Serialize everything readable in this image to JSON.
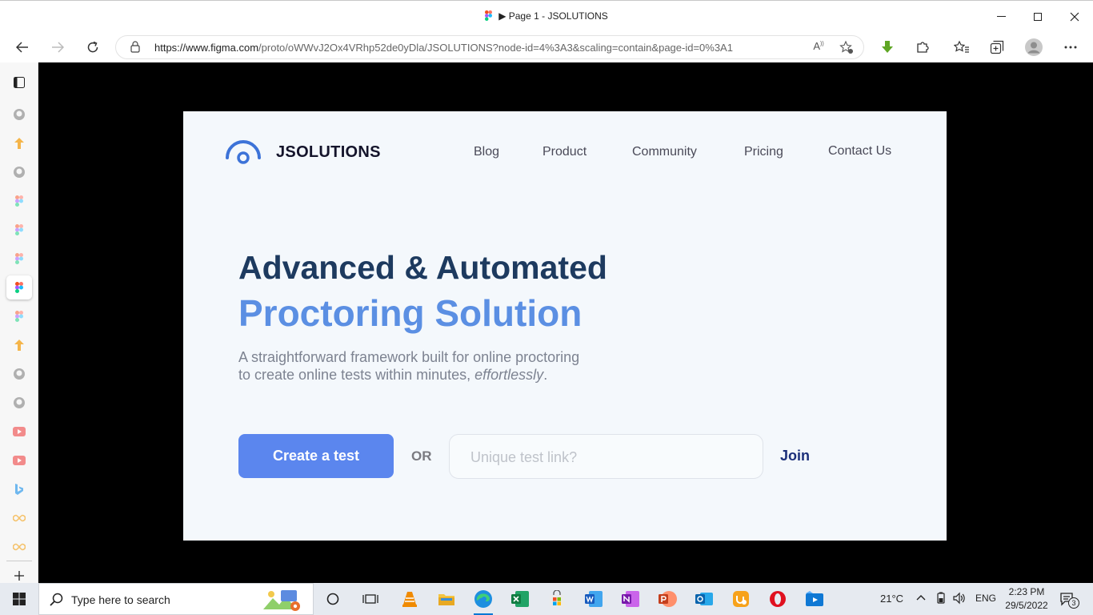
{
  "browser": {
    "window_title": "▶ Page 1 - JSOLUTIONS",
    "url": "https://www.figma.com/proto/oWWvJ2Ox4VRhp52de0yDla/JSOLUTIONS?node-id=4%3A3&scaling=contain&page-id=0%3A1",
    "url_host": "https://www.figma.com",
    "url_path": "/proto/oWWvJ2Ox4VRhp52de0yDla/JSOLUTIONS?node-id=4%3A3&scaling=contain&page-id=0%3A1"
  },
  "sidebar": {
    "items": [
      {
        "icon": "github-icon"
      },
      {
        "icon": "upload-arrow-icon"
      },
      {
        "icon": "github-icon"
      },
      {
        "icon": "figma-icon"
      },
      {
        "icon": "figma-icon"
      },
      {
        "icon": "figma-icon"
      },
      {
        "icon": "figma-icon",
        "active": true
      },
      {
        "icon": "figma-icon"
      },
      {
        "icon": "upload-arrow-icon"
      },
      {
        "icon": "github-icon"
      },
      {
        "icon": "github-icon"
      },
      {
        "icon": "youtube-icon"
      },
      {
        "icon": "youtube-icon"
      },
      {
        "icon": "bing-icon"
      },
      {
        "icon": "infinity-icon"
      },
      {
        "icon": "infinity-icon"
      }
    ]
  },
  "site": {
    "brand": "JSOLUTIONS",
    "nav": [
      "Blog",
      "Product",
      "Community",
      "Pricing",
      "Contact Us"
    ],
    "hero_line1": "Advanced & Automated",
    "hero_line2": "Proctoring Solution",
    "sub_line1": "A straightforward framework built for online proctoring",
    "sub_line2_pre": "to create online tests within minutes, ",
    "sub_line2_em": "effortlessly",
    "sub_line2_post": ".",
    "cta_label": "Create a test",
    "or_label": "OR",
    "link_placeholder": "Unique test link?",
    "join_label": "Join"
  },
  "taskbar": {
    "search_placeholder": "Type here to search",
    "temperature": "21°C",
    "language": "ENG",
    "time": "2:23 PM",
    "date": "29/5/2022",
    "notification_count": "3"
  },
  "colors": {
    "accent": "#5b86ee",
    "hero_dark": "#1d3a5f",
    "hero_blue": "#5b8fe3",
    "join": "#1b2f7a"
  }
}
